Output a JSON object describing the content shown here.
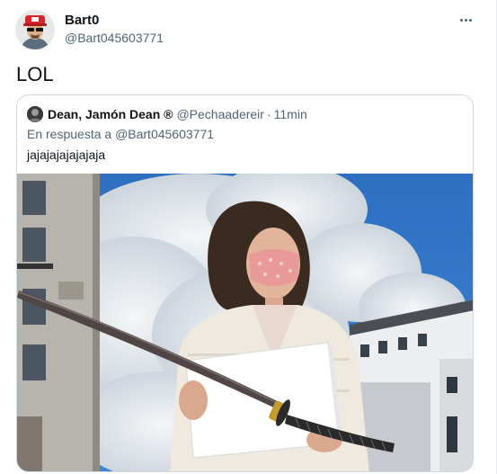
{
  "tweet": {
    "author_name": "Bart0",
    "author_handle": "@Bart045603771",
    "text": "LOL",
    "more_icon": "more-horizontal-icon"
  },
  "quoted_tweet": {
    "author_name": "Dean, Jamón Dean ®",
    "author_handle": "@Pechaadereir",
    "separator": "·",
    "time": "11min",
    "reply_prefix": "En respuesta a",
    "reply_handle": "@Bart045603771",
    "text": "jajajajajajajaja"
  },
  "colors": {
    "text_primary": "#0f1419",
    "text_secondary": "#536471",
    "border": "#cfd9de",
    "sky": "#2f72c4"
  }
}
